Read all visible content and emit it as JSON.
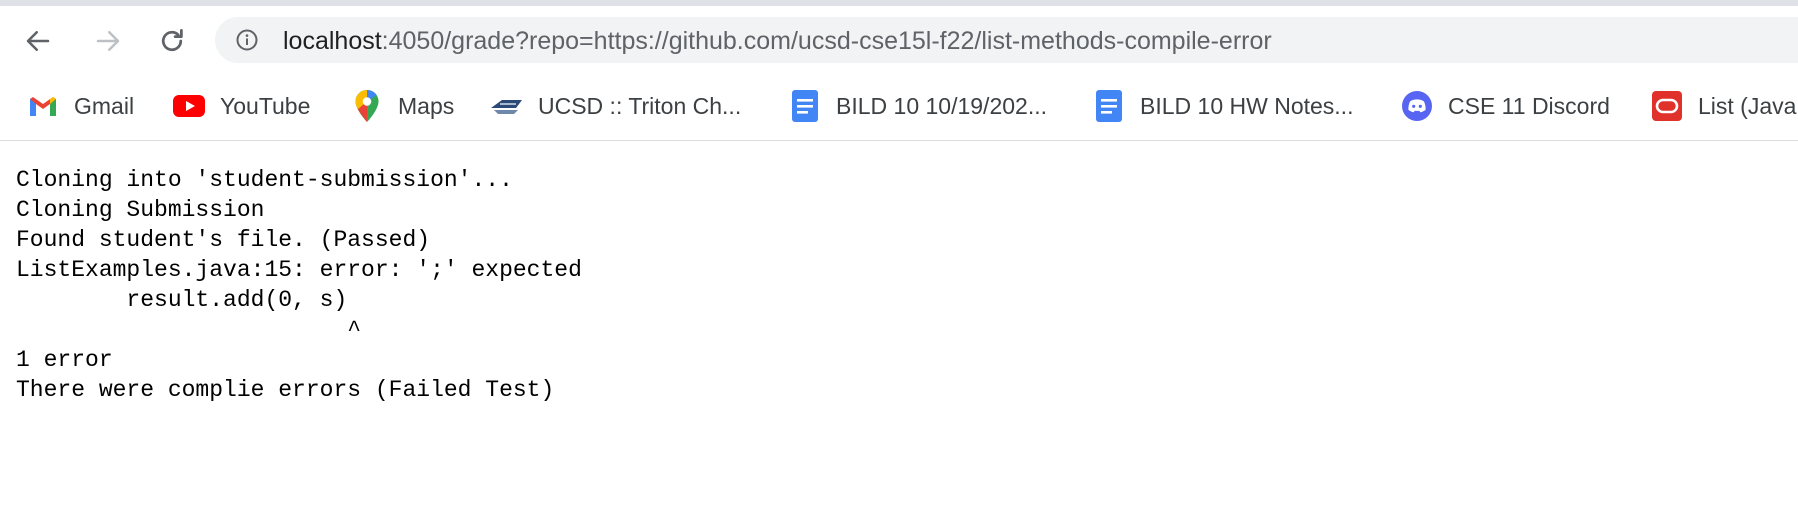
{
  "browser": {
    "nav": {
      "back_icon": "arrow-left-icon",
      "forward_icon": "arrow-right-icon",
      "reload_icon": "reload-icon"
    },
    "address_bar": {
      "info_icon": "info-icon",
      "host": "localhost",
      "rest": ":4050/grade?repo=https://github.com/ucsd-cse15l-f22/list-methods-compile-error"
    },
    "bookmarks": [
      {
        "label": "Gmail",
        "icon": "gmail-icon"
      },
      {
        "label": "YouTube",
        "icon": "youtube-icon"
      },
      {
        "label": "Maps",
        "icon": "maps-icon"
      },
      {
        "label": "UCSD :: Triton Ch...",
        "icon": "triton-icon"
      },
      {
        "label": "BILD 10 10/19/202...",
        "icon": "docs-icon"
      },
      {
        "label": "BILD 10 HW Notes...",
        "icon": "docs-icon"
      },
      {
        "label": "CSE 11 Discord",
        "icon": "discord-icon"
      },
      {
        "label": "List (Java",
        "icon": "oracle-icon"
      }
    ]
  },
  "page": {
    "output_lines": [
      "Cloning into 'student-submission'...",
      "Cloning Submission",
      "Found student's file. (Passed)",
      "ListExamples.java:15: error: ';' expected",
      "        result.add(0, s)",
      "                        ^",
      "1 error",
      "There were complie errors (Failed Test)"
    ]
  },
  "colors": {
    "toolbar_bg": "#ffffff",
    "omnibox_bg": "#f1f3f4",
    "text_dark": "#202124",
    "text_muted": "#5f6368",
    "gmail_red": "#ea4335",
    "youtube_red": "#ff0000",
    "docs_blue": "#4285f4",
    "discord_blurple": "#5865f2",
    "oracle_red": "#e0312b"
  }
}
